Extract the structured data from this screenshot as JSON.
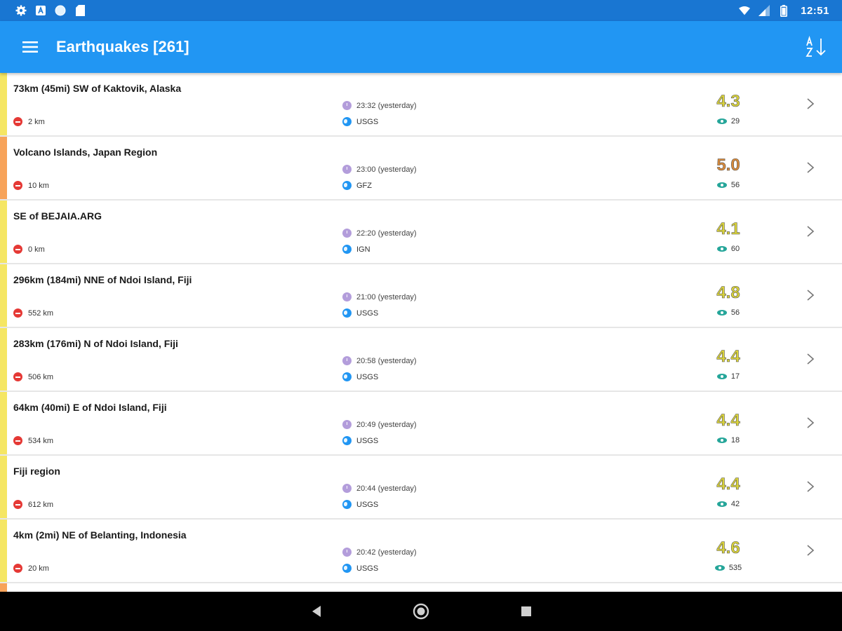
{
  "status_bar": {
    "time": "12:51",
    "left_icons": [
      "settings-icon",
      "a-icon",
      "circle-icon",
      "sd-card-icon"
    ],
    "right_icons": [
      "wifi-icon",
      "signal-icon",
      "battery-icon"
    ]
  },
  "app_bar": {
    "title": "Earthquakes [261]",
    "menu_icon": "hamburger-icon",
    "sort_icon": "sort-az-icon",
    "color": "#2196f3"
  },
  "quakes": [
    {
      "place": "73km (45mi) SW of Kaktovik, Alaska",
      "depth": "2 km",
      "time": "23:32 (yesterday)",
      "source": "USGS",
      "magnitude": "4.3",
      "views": "29",
      "severity_color": "#f5e663",
      "mag_color": "#d9d23a"
    },
    {
      "place": "Volcano Islands, Japan Region",
      "depth": "10 km",
      "time": "23:00 (yesterday)",
      "source": "GFZ",
      "magnitude": "5.0",
      "views": "56",
      "severity_color": "#f7a35a",
      "mag_color": "#d98a3a"
    },
    {
      "place": "SE of  BEJAIA.ARG",
      "depth": "0 km",
      "time": "22:20 (yesterday)",
      "source": "IGN",
      "magnitude": "4.1",
      "views": "60",
      "severity_color": "#f5e663",
      "mag_color": "#d9d23a"
    },
    {
      "place": "296km (184mi) NNE of Ndoi Island, Fiji",
      "depth": "552 km",
      "time": "21:00 (yesterday)",
      "source": "USGS",
      "magnitude": "4.8",
      "views": "56",
      "severity_color": "#f5e663",
      "mag_color": "#d9d23a"
    },
    {
      "place": "283km (176mi) N of Ndoi Island, Fiji",
      "depth": "506 km",
      "time": "20:58 (yesterday)",
      "source": "USGS",
      "magnitude": "4.4",
      "views": "17",
      "severity_color": "#f5e663",
      "mag_color": "#d9d23a"
    },
    {
      "place": "64km (40mi) E of Ndoi Island, Fiji",
      "depth": "534 km",
      "time": "20:49 (yesterday)",
      "source": "USGS",
      "magnitude": "4.4",
      "views": "18",
      "severity_color": "#f5e663",
      "mag_color": "#d9d23a"
    },
    {
      "place": "Fiji region",
      "depth": "612 km",
      "time": "20:44 (yesterday)",
      "source": "USGS",
      "magnitude": "4.4",
      "views": "42",
      "severity_color": "#f5e663",
      "mag_color": "#d9d23a"
    },
    {
      "place": "4km (2mi) NE of Belanting, Indonesia",
      "depth": "20 km",
      "time": "20:42 (yesterday)",
      "source": "USGS",
      "magnitude": "4.6",
      "views": "535",
      "severity_color": "#f5e663",
      "mag_color": "#d9d23a"
    }
  ],
  "partial_row_color": "#f7a35a",
  "nav_bar": {
    "icons": [
      "back-icon",
      "home-icon",
      "recents-icon"
    ]
  }
}
